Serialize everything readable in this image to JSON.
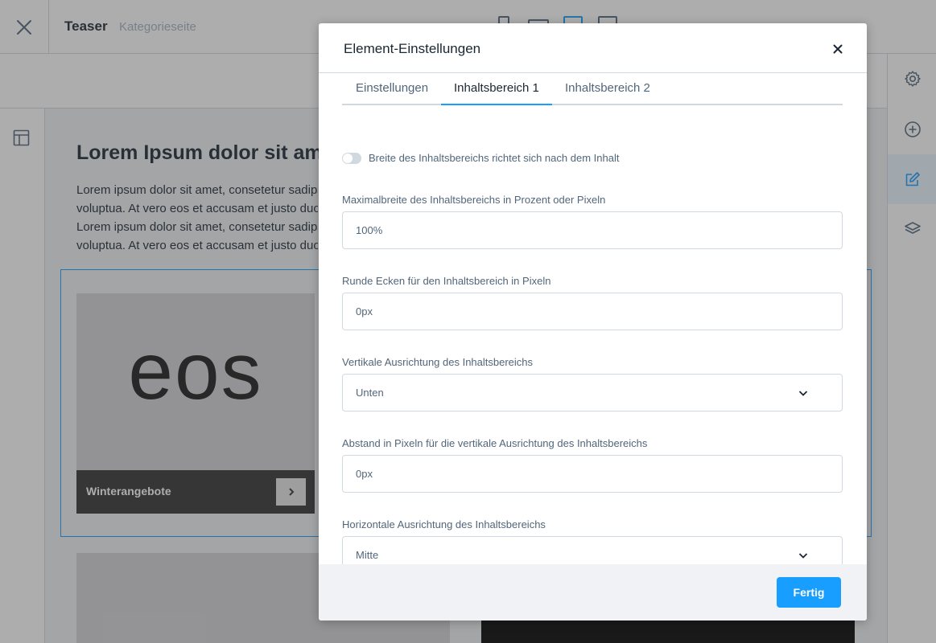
{
  "app": {
    "title": "Teaser",
    "subtitle": "Kategorieseite"
  },
  "content": {
    "heading": "Lorem Ipsum dolor sit ame",
    "paragraph_lines": [
      "Lorem ipsum dolor sit amet, consetetur sadipsc",
      "voluptua. At vero eos et accusam et justo duo d",
      "Lorem ipsum dolor sit amet, consetetur sadipsc",
      "voluptua. At vero eos et accusam et justo duo d"
    ],
    "teaser": {
      "image_word": "eos",
      "label": "Winterangebote"
    }
  },
  "modal": {
    "title": "Element-Einstellungen",
    "tabs": [
      {
        "label": "Einstellungen",
        "active": false
      },
      {
        "label": "Inhaltsbereich 1",
        "active": true
      },
      {
        "label": "Inhaltsbereich 2",
        "active": false
      }
    ],
    "toggle": {
      "label": "Breite des Inhaltsbereichs richtet sich nach dem Inhalt",
      "on": false
    },
    "fields": [
      {
        "label": "Maximalbreite des Inhaltsbereichs in Prozent oder Pixeln",
        "value": "100%",
        "type": "text"
      },
      {
        "label": "Runde Ecken für den Inhaltsbereich in Pixeln",
        "value": "0px",
        "type": "text"
      },
      {
        "label": "Vertikale Ausrichtung des Inhaltsbereichs",
        "value": "Unten",
        "type": "select"
      },
      {
        "label": "Abstand in Pixeln für die vertikale Ausrichtung des Inhaltsbereichs",
        "value": "0px",
        "type": "text"
      },
      {
        "label": "Horizontale Ausrichtung des Inhaltsbereichs",
        "value": "Mitte",
        "type": "select"
      }
    ],
    "done_label": "Fertig"
  },
  "colors": {
    "accent": "#189eff",
    "overlay": "rgba(60,60,60,0.42)",
    "text_dark": "#1a2733",
    "text_muted": "#52667a",
    "border": "#d1d9e0",
    "footer_bg": "#f0f2f5"
  },
  "icons": {
    "close": "close-icon",
    "layout": "layout-icon",
    "settings": "gear-icon",
    "add": "plus-circle-icon",
    "edit": "edit-icon",
    "layers": "layers-icon",
    "chevron": "chevron-down-icon",
    "arrow": "chevron-right-icon"
  }
}
